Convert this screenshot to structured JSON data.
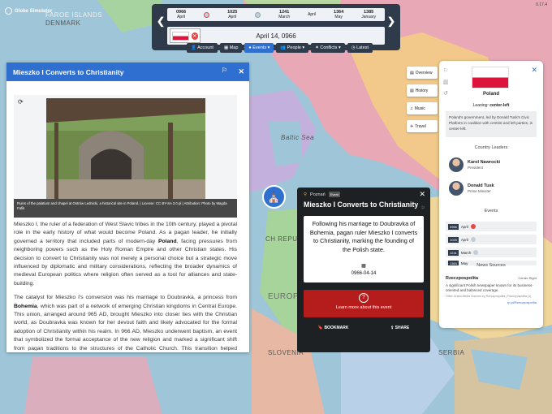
{
  "app": {
    "logo_text": "Globe Simulator",
    "version": "0.17.4"
  },
  "map_labels": {
    "faroe": "FAROE ISLANDS",
    "denmark": "DENMARK",
    "baltic": "Baltic Sea",
    "czech": "CH REPUBLIC",
    "slovenia": "SLOVENIA",
    "serbia": "SERBIA",
    "europe": "EUROPE"
  },
  "timeline": {
    "items": [
      {
        "year": "0966",
        "month": "April"
      },
      {
        "year": "1025",
        "month": "April"
      },
      {
        "year": "1241",
        "month": "March"
      },
      {
        "year": "1364",
        "month": "May"
      },
      {
        "year": "1385",
        "month": "January"
      }
    ],
    "extra_month": "April",
    "current_date": "April 14, 0966"
  },
  "navbar": [
    "Account",
    "Map",
    "Events",
    "People",
    "Conflicts",
    "Latest"
  ],
  "left_panel": {
    "title": "Mieszko I Converts to Christianity",
    "caption": "Ruins of the palatium and chapel at Ostrów Lednicki, a historical site in Poland. | License: CC BY-SA 3.0 pl | Attribution: Photo by Magda Fafik",
    "para1_a": "Mieszko I, the ruler of a federation of West Slavic tribes in the 10th century, played a pivotal role in the early history of what would become Poland. As a pagan leader, he initially governed a territory that included parts of modern-day ",
    "para1_bold": "Poland",
    "para1_b": ", facing pressures from neighboring powers such as the Holy Roman Empire and other Christian states. His decision to convert to Christianity was not merely a personal choice but a strategic move influenced by diplomatic and military considerations, reflecting the broader dynamics of medieval European politics where religion often served as a tool for alliances and state-building.",
    "para2_a": "The catalyst for Mieszko I's conversion was his marriage to Doubravka, a princess from ",
    "para2_bold": "Bohemia",
    "para2_b": ", which was part of a network of emerging Christian kingdoms in Central Europe. This union, arranged around 965 AD, brought Mieszko into closer ties with the Christian world, as Doubravka was known for her devout faith and likely advocated for the formal adoption of Christianity within his realm. In 966 AD, Mieszko underwent baptism, an event that symbolized the formal acceptance of the new religion and marked a significant shift from pagan traditions to the structures of the Catholic Church. This transition helped consolidate his authority and facilitated interactions with other"
  },
  "popup": {
    "location": "Poznań",
    "badge": "Event",
    "title": "Mieszko I Converts to Christianity",
    "summary": "Following his marriage to Doubravka of Bohemia, pagan ruler Mieszko I converts to Christianity, marking the founding of the Polish state.",
    "date": "0966-04-14",
    "learn_more": "Learn more about this event",
    "bookmark": "BOOKMARK",
    "share": "SHARE"
  },
  "side_tabs": [
    "Overview",
    "History",
    "Music",
    "Travel"
  ],
  "right_panel": {
    "country": "Poland",
    "leaning_label": "Leaning:",
    "leaning_value": "center-left",
    "description": "Poland's government, led by Donald Tusk's Civic Platform in coalition with centrist and left parties, is center-left.",
    "leaders_title": "Country Leaders",
    "leaders": [
      {
        "name": "Karol Nawrocki",
        "role": "President"
      },
      {
        "name": "Donald Tusk",
        "role": "Prime Minister"
      }
    ],
    "events_title": "Events",
    "events": [
      {
        "year": "0966",
        "month": "April"
      },
      {
        "year": "1025",
        "month": "April"
      },
      {
        "year": "1241",
        "month": "March"
      },
      {
        "year": "1364",
        "month": "May"
      }
    ],
    "news_title": "News Sources",
    "news": {
      "name": "Rzeczpospolita",
      "leaning": "Center-Right",
      "text": "A significant Polish newspaper known for its business-oriented and balanced coverage.",
      "note": "Other Grand-Media Sources by Rzeczpospolita | Rzeczpospolita (1)",
      "link": "rp.pl/Rzeczpospolita"
    }
  },
  "colors": {
    "accent": "#2f6fd0",
    "dark": "#2f3a4a",
    "learn_button": "#b51c1c",
    "poland_red": "#dc143c"
  }
}
